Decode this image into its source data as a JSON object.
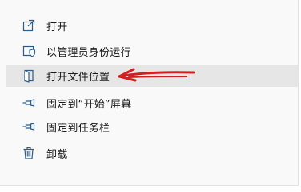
{
  "context_menu": {
    "items": [
      {
        "label": "打开",
        "icon": "open-external-icon"
      },
      {
        "label": "以管理员身份运行",
        "icon": "shield-admin-icon"
      },
      {
        "label": "打开文件位置",
        "icon": "folder-location-icon",
        "highlighted": true
      },
      {
        "label": "固定到“开始”屏幕",
        "icon": "pin-icon"
      },
      {
        "label": "固定到任务栏",
        "icon": "pin-icon"
      },
      {
        "label": "卸载",
        "icon": "trash-icon"
      }
    ]
  },
  "colors": {
    "menu_bg": "#f9f9f9",
    "hover_bg": "#e6e6e6",
    "icon_stroke": "#2a5d8a",
    "annotation_arrow": "#d22020"
  }
}
